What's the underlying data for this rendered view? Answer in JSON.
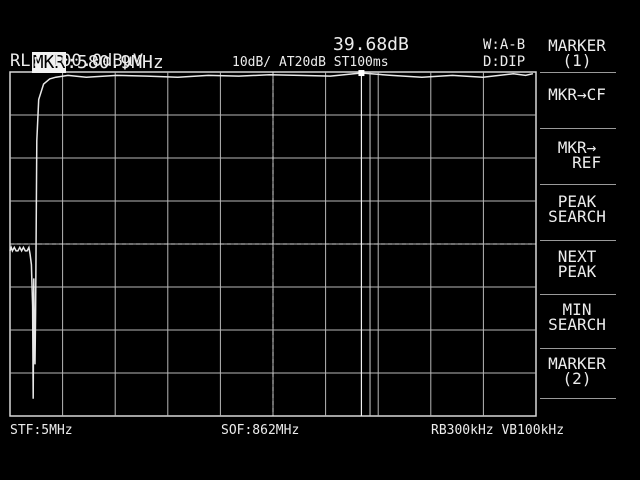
{
  "header": {
    "marker_label": "MKR",
    "marker_freq": ":580.9MHz",
    "marker_level": "39.68dB",
    "ref_level": "RL: 100.0dBμV",
    "settings": "10dB/ AT20dB ST100ms",
    "trace_mode": "W:A-B",
    "display_mode": "D:DIP"
  },
  "softkeys": [
    {
      "label": "MARKER\n(1)"
    },
    {
      "label": "MKR→CF"
    },
    {
      "label": "MKR→\n  REF"
    },
    {
      "label": "PEAK\nSEARCH"
    },
    {
      "label": "NEXT\nPEAK"
    },
    {
      "label": "MIN\nSEARCH"
    },
    {
      "label": "MARKER\n(2)"
    }
  ],
  "footer": {
    "start_freq": "STF:5MHz",
    "span_freq": "SOF:862MHz",
    "bandwidth": "RB300kHz VB100kHz"
  },
  "chart_data": {
    "type": "line",
    "x_unit": "MHz",
    "y_unit": "dB",
    "xlim": [
      5,
      867
    ],
    "ylim": [
      -100,
      0
    ],
    "divisions": {
      "x": 10,
      "y": 8
    },
    "grid": true,
    "series": [
      {
        "x": [
          5,
          7,
          9,
          12,
          15,
          18,
          21,
          24,
          27,
          30,
          33,
          36,
          38,
          40,
          42,
          43,
          44,
          45,
          46,
          47,
          48,
          49,
          52,
          60,
          70,
          80,
          100,
          130,
          180,
          230,
          280,
          330,
          380,
          430,
          480,
          530,
          580.9,
          630,
          680,
          730,
          780,
          830,
          850,
          862
        ],
        "y": [
          -52,
          -51,
          -52,
          -51,
          -52,
          -52,
          -51,
          -52,
          -51,
          -52,
          -52,
          -51,
          -53,
          -56,
          -68,
          -95,
          -60,
          -78,
          -85,
          -70,
          -45,
          -20,
          -8,
          -3.5,
          -2,
          -1.5,
          -1,
          -1.5,
          -1,
          -1.2,
          -1.5,
          -1,
          -1.2,
          -0.8,
          -1,
          -1.2,
          -0.3,
          -1,
          -1.5,
          -1,
          -1.5,
          -0.5,
          -1,
          -0.5
        ]
      }
    ],
    "marker_x": 580.9,
    "delta_marker_x": 595,
    "center_line_x": 436,
    "reference_line_y": -50
  }
}
